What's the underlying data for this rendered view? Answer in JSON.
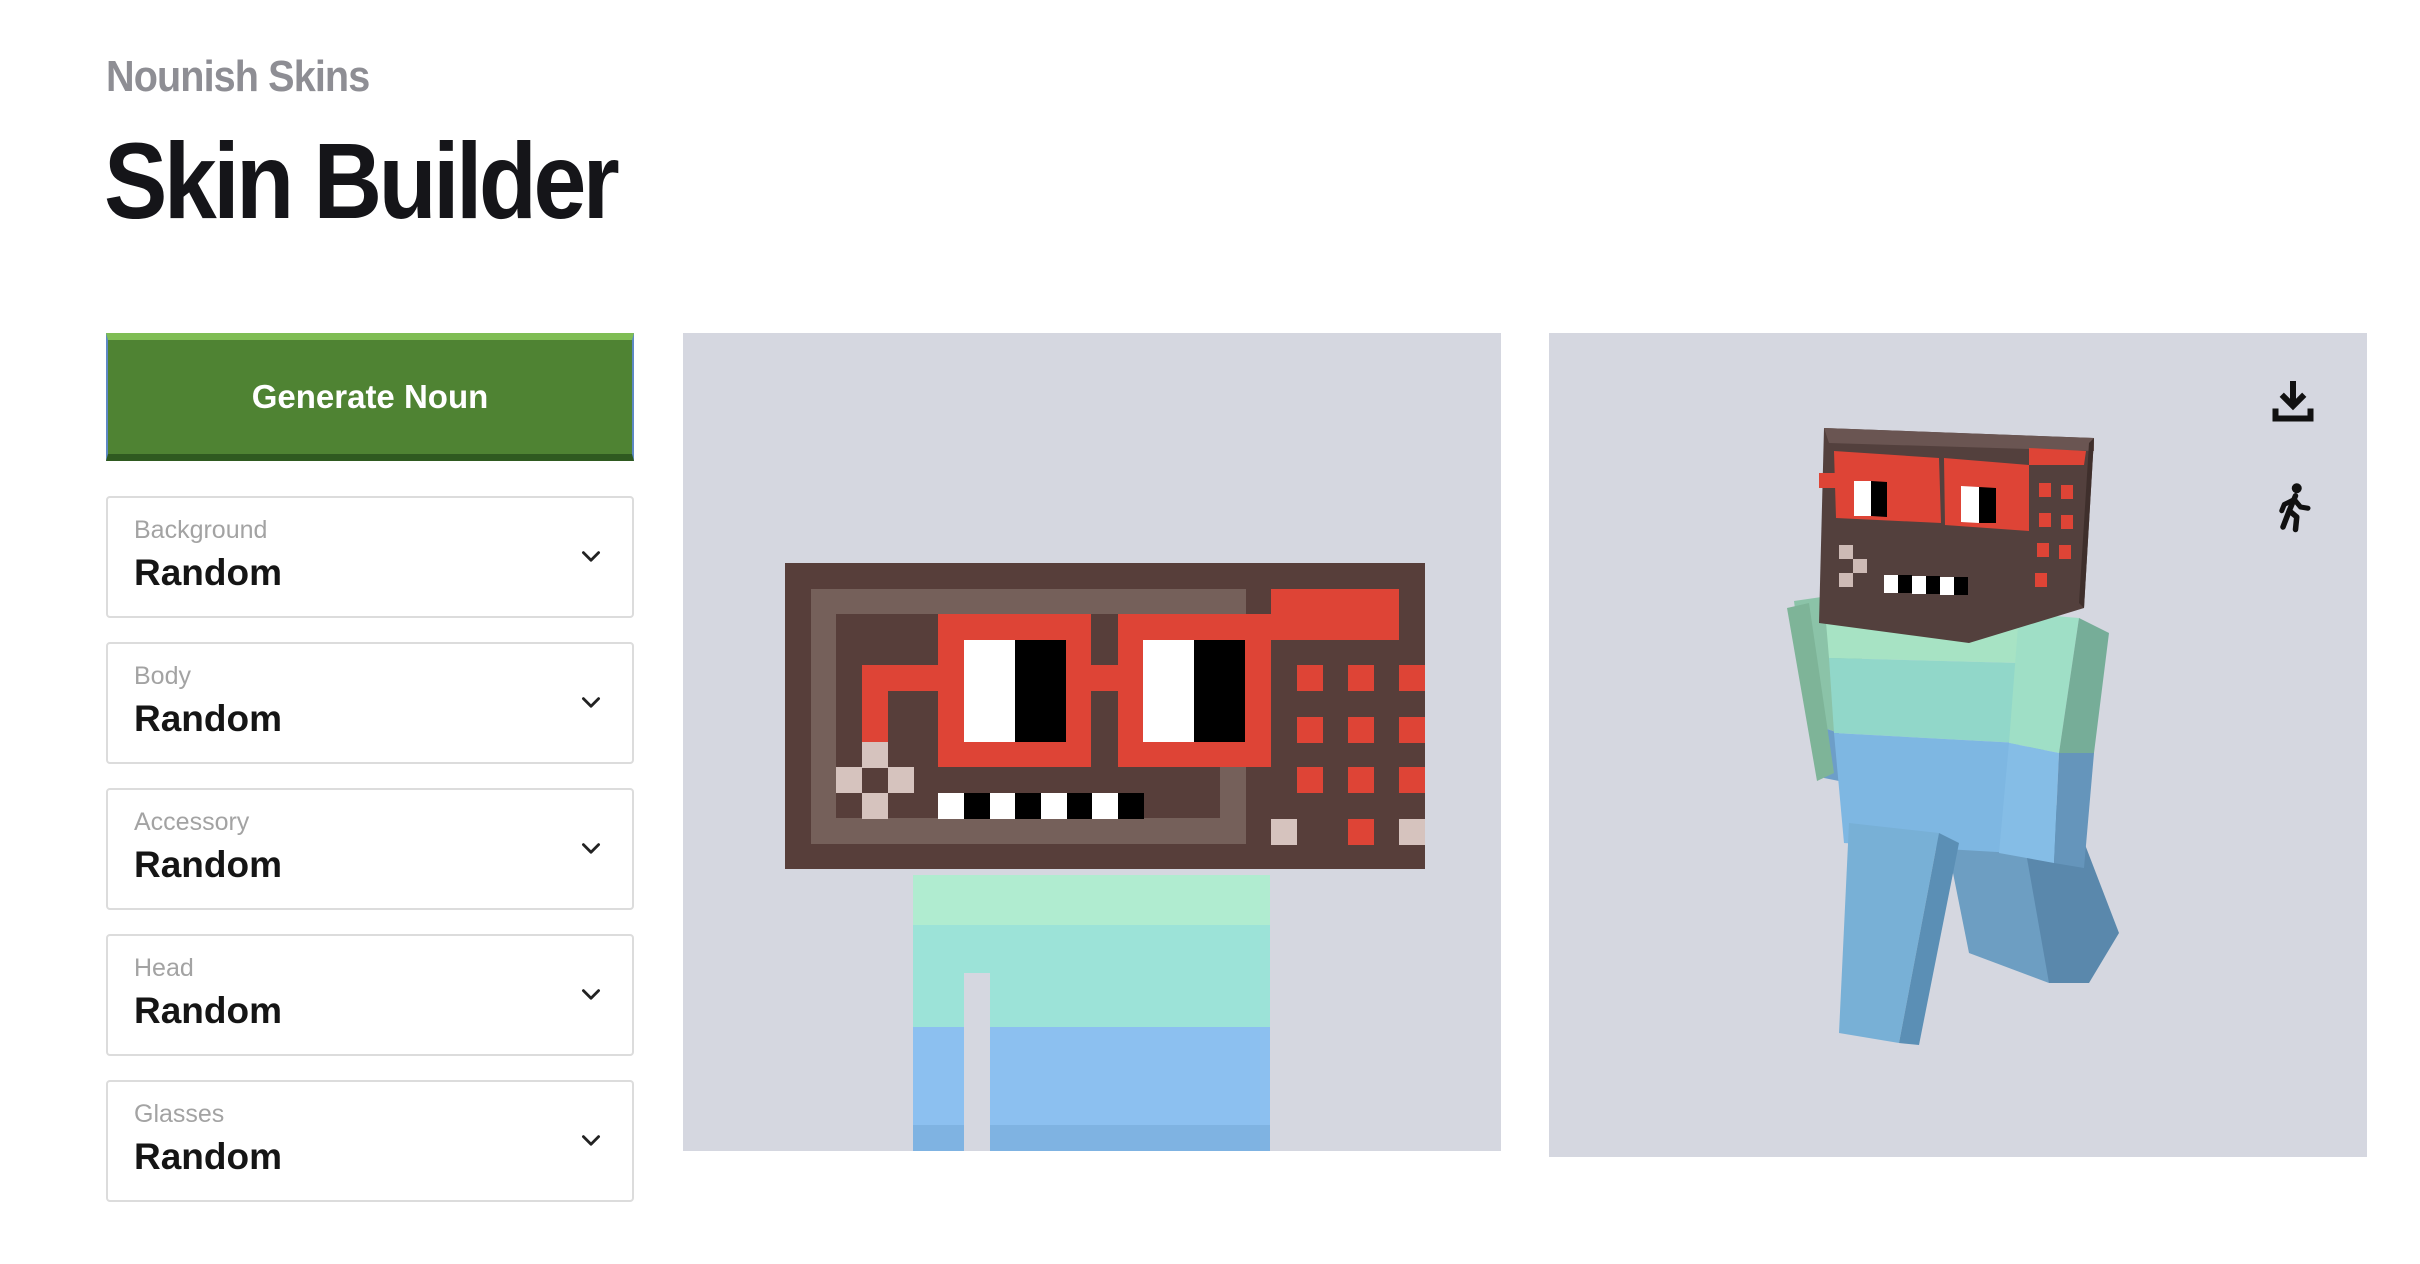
{
  "header": {
    "subtitle": "Nounish Skins",
    "title": "Skin Builder"
  },
  "generate_button": {
    "label": "Generate Noun"
  },
  "selects": [
    {
      "label": "Background",
      "value": "Random"
    },
    {
      "label": "Body",
      "value": "Random"
    },
    {
      "label": "Accessory",
      "value": "Random"
    },
    {
      "label": "Head",
      "value": "Random"
    },
    {
      "label": "Glasses",
      "value": "Random"
    }
  ],
  "preview_icons": {
    "download": "download-icon",
    "animate": "walking-person-icon"
  },
  "colors": {
    "button_green": "#4f8333",
    "panel_bg": "#d5d7e0",
    "glasses_red": "#de4436",
    "head_brown": "#573e3a",
    "body_top": "#b0ecd0",
    "body_mid": "#9ce3d8",
    "body_bottom": "#8cc0f0"
  }
}
